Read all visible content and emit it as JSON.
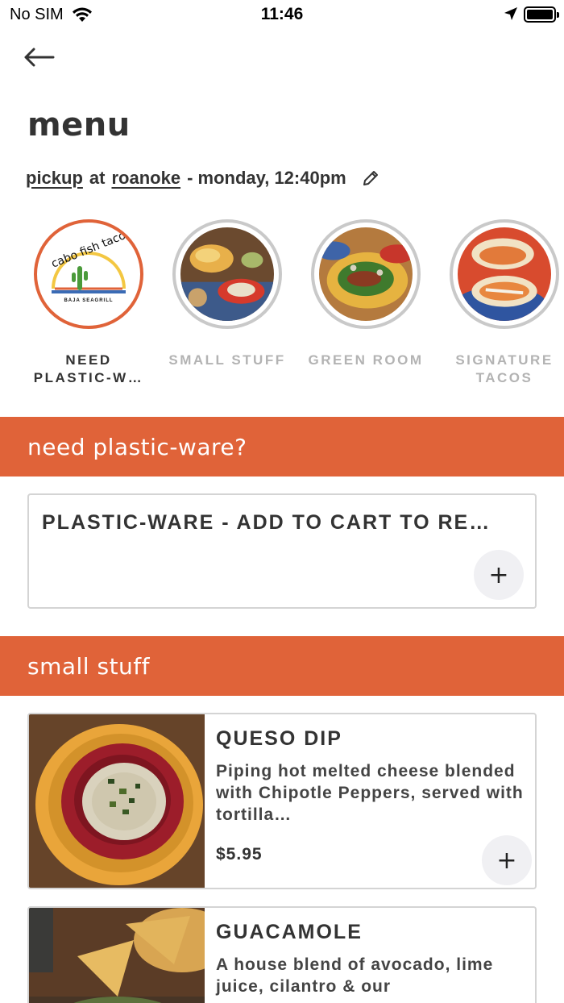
{
  "status_bar": {
    "carrier": "No SIM",
    "time": "11:46"
  },
  "header": {
    "title": "menu",
    "order_mode": "pickup",
    "at": "at",
    "location": "roanoke",
    "schedule": "- monday, 12:40pm"
  },
  "categories": [
    {
      "label": "NEED PLASTIC-W…",
      "active": true
    },
    {
      "label": "SMALL STUFF",
      "active": false
    },
    {
      "label": "GREEN ROOM",
      "active": false
    },
    {
      "label": "SIGNATURE TACOS",
      "active": false
    }
  ],
  "logo": {
    "line1": "cabo fish taco",
    "line2": "BAJA SEAGRILL"
  },
  "sections": [
    {
      "title": "need plastic-ware?",
      "items": [
        {
          "name": "PLASTIC-WARE - ADD TO CART TO RE…",
          "add_label": "+"
        }
      ]
    },
    {
      "title": "small stuff",
      "items": [
        {
          "name": "QUESO DIP",
          "description": "Piping hot melted cheese blended with Chipotle Peppers, served with tortilla…",
          "price": "$5.95",
          "add_label": "+"
        },
        {
          "name": "GUACAMOLE",
          "description": "A house blend of avocado, lime juice, cilantro & our",
          "price": "",
          "add_label": "+"
        }
      ]
    }
  ],
  "colors": {
    "accent": "#e06339",
    "inactive_border": "#c9c9c9",
    "text": "#333333"
  }
}
